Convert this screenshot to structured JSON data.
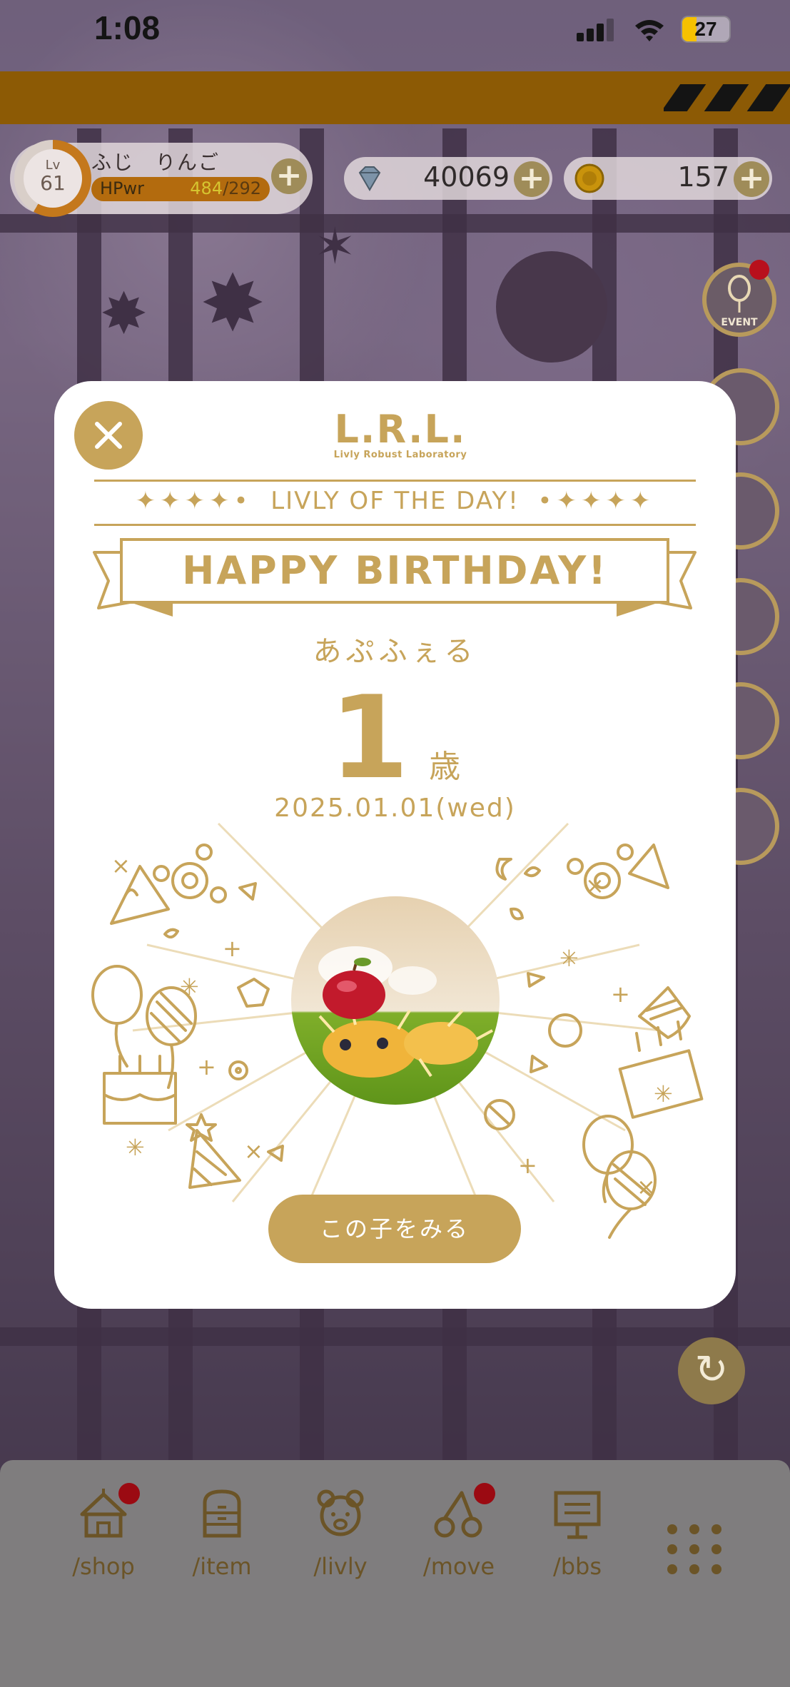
{
  "status_bar": {
    "time": "1:08",
    "battery": "27"
  },
  "player": {
    "level_label": "Lv",
    "level": "61",
    "name": "ふじ　りんご",
    "hp_label": "HPwr",
    "hp_current": "484",
    "hp_max": "/292"
  },
  "currency": {
    "gems": "40069",
    "coins": "157"
  },
  "event_button": {
    "label": "EVENT"
  },
  "modal": {
    "logo": "L.R.L.",
    "logo_sub": "Livly Robust Laboratory",
    "section_title": "LIVLY OF THE DAY!",
    "deco_left": "✦✦✦✦•",
    "deco_right": "•✦✦✦✦",
    "banner": "HAPPY BIRTHDAY!",
    "livly_name": "あぷふぇる",
    "age": "1",
    "age_unit": "歳",
    "date": "2025.01.01(wed)",
    "view_button": "この子をみる"
  },
  "nav": {
    "items": [
      {
        "label": "/shop",
        "icon": "tent-icon",
        "badge": true
      },
      {
        "label": "/item",
        "icon": "drawer-icon",
        "badge": false
      },
      {
        "label": "/livly",
        "icon": "bear-face-icon",
        "badge": false
      },
      {
        "label": "/move",
        "icon": "compass-icon",
        "badge": true
      },
      {
        "label": "/bbs",
        "icon": "board-icon",
        "badge": false
      }
    ],
    "more_icon": "grid-menu-icon"
  },
  "colors": {
    "accent_gold": "#c7a45a",
    "banner_brown": "#8c5a05",
    "notification_red": "#b8101c"
  }
}
